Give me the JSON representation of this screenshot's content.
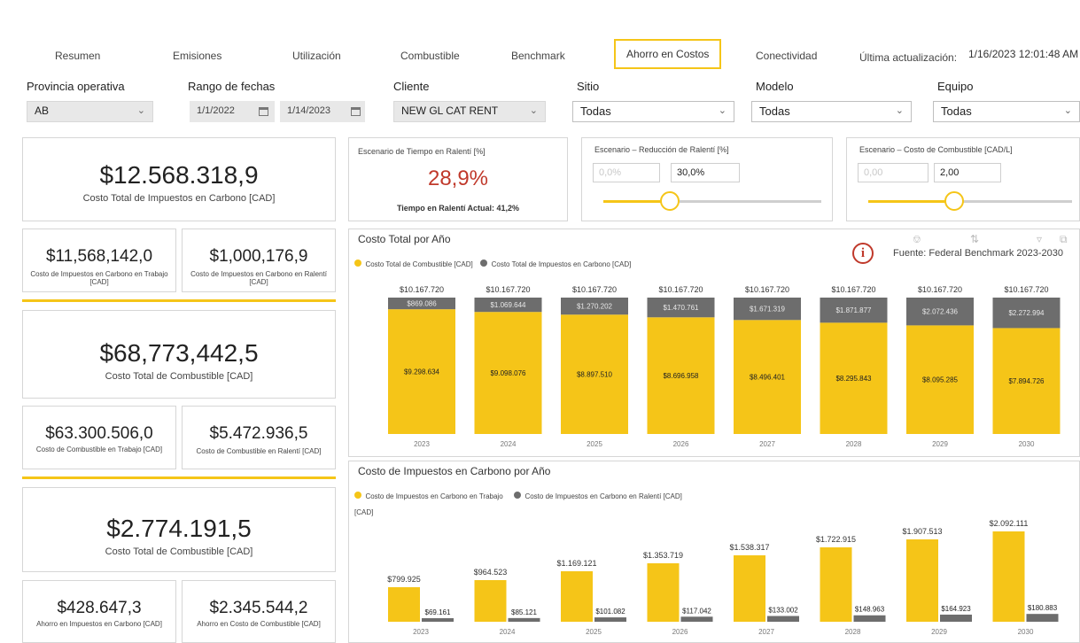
{
  "tabs": {
    "resumen": "Resumen",
    "emisiones": "Emisiones",
    "utilizacion": "Utilización",
    "combustible": "Combustible",
    "benchmark": "Benchmark",
    "ahorro": "Ahorro en Costos",
    "conectividad": "Conectividad",
    "updated_label": "Última actualización:",
    "updated_value": "1/16/2023 12:01:48 AM"
  },
  "filters": {
    "provincia_label": "Provincia operativa",
    "provincia_value": "AB",
    "fechas_label": "Rango de fechas",
    "fecha_inicio": "1/1/2022",
    "fecha_fin": "1/14/2023",
    "cliente_label": "Cliente",
    "cliente_value": "NEW GL CAT RENT",
    "sitio_label": "Sitio",
    "sitio_value": "Todas",
    "modelo_label": "Modelo",
    "modelo_value": "Todas",
    "equipo_label": "Equipo",
    "equipo_value": "Todas"
  },
  "kpis": {
    "carbon_total": "$12.568.318,9",
    "carbon_total_label": "Costo Total de Impuestos en Carbono [CAD]",
    "carbon_work": "$11,568,142,0",
    "carbon_work_label": "Costo de Impuestos en Carbono en Trabajo [CAD]",
    "carbon_idle": "$1,000,176,9",
    "carbon_idle_label": "Costo de Impuestos en Carbono en Ralentí [CAD]",
    "fuel_total": "$68,773,442,5",
    "fuel_total_label": "Costo Total de Combustible [CAD]",
    "fuel_work": "$63.300.506,0",
    "fuel_work_label": "Costo de Combustible en Trabajo [CAD]",
    "fuel_idle": "$5.472.936,5",
    "fuel_idle_label": "Costo de Combustible en Ralentí [CAD]",
    "savings_total": "$2.774.191,5",
    "savings_total_label": "Costo Total de Combustible [CAD]",
    "savings_carbon": "$428.647,3",
    "savings_carbon_label": "Ahorro en Impuestos en Carbono [CAD]",
    "savings_fuel": "$2.345.544,2",
    "savings_fuel_label": "Ahorro en Costo de Combustible [CAD]"
  },
  "scenarios": {
    "idle_time_title": "Escenario de Tiempo en Ralentí [%]",
    "idle_time_value": "28,9%",
    "idle_time_actual": "Tiempo en Ralentí Actual: 41,2%",
    "idle_reduction_title": "Escenario – Reducción de Ralentí [%]",
    "idle_reduction_min": "0,0%",
    "idle_reduction_value": "30,0%",
    "fuel_cost_title": "Escenario – Costo de Combustible [CAD/L]",
    "fuel_cost_min": "0,00",
    "fuel_cost_value": "2,00"
  },
  "colors": {
    "accent": "#f5c518",
    "gray_series": "#6d6d6d",
    "highlight_red": "#c0392b"
  },
  "icons": [
    "calendar-icon",
    "chevron-down-icon",
    "info-icon"
  ],
  "source_note": "Fuente: Federal Benchmark 2023-2030",
  "chart_data": [
    {
      "type": "bar",
      "stacked": true,
      "title": "Costo Total por Año",
      "categories": [
        "2023",
        "2024",
        "2025",
        "2026",
        "2027",
        "2028",
        "2029",
        "2030"
      ],
      "series": [
        {
          "name": "Costo Total de Combustible [CAD]",
          "color": "#f5c518",
          "values": [
            9298634,
            9098076,
            8897510,
            8696958,
            8496401,
            8295843,
            8095285,
            7894726
          ],
          "labels": [
            "$9.298.634",
            "$9.098.076",
            "$8.897.510",
            "$8.696.958",
            "$8.496.401",
            "$8.295.843",
            "$8.095.285",
            "$7.894.726"
          ]
        },
        {
          "name": "Costo Total de Impuestos en Carbono [CAD]",
          "color": "#6d6d6d",
          "values": [
            869086,
            1069644,
            1270202,
            1470761,
            1671319,
            1871877,
            2072436,
            2272994
          ],
          "labels": [
            "$869.086",
            "$1.069.644",
            "$1.270.202",
            "$1.470.761",
            "$1.671.319",
            "$1.871.877",
            "$2.072.436",
            "$2.272.994"
          ]
        }
      ],
      "totals": [
        "$10.167.720",
        "$10.167.720",
        "$10.167.720",
        "$10.167.720",
        "$10.167.720",
        "$10.167.720",
        "$10.167.720",
        "$10.167.720"
      ]
    },
    {
      "type": "bar",
      "title": "Costo de Impuestos en Carbono por Año",
      "categories": [
        "2023",
        "2024",
        "2025",
        "2026",
        "2027",
        "2028",
        "2029",
        "2030"
      ],
      "series": [
        {
          "name": "Costo de Impuestos en Carbono en Trabajo [CAD]",
          "color": "#f5c518",
          "values": [
            799925,
            964523,
            1169121,
            1353719,
            1538317,
            1722915,
            1907513,
            2092111
          ],
          "labels": [
            "$799.925",
            "$964.523",
            "$1.169.121",
            "$1.353.719",
            "$1.538.317",
            "$1.722.915",
            "$1.907.513",
            "$2.092.111"
          ]
        },
        {
          "name": "Costo de Impuestos en Carbono en Ralentí [CAD]",
          "color": "#6d6d6d",
          "values": [
            69161,
            85121,
            101082,
            117042,
            133002,
            148963,
            164923,
            180883
          ],
          "labels": [
            "$69.161",
            "$85.121",
            "$101.082",
            "$117.042",
            "$133.002",
            "$148.963",
            "$164.923",
            "$180.883"
          ]
        }
      ]
    }
  ]
}
